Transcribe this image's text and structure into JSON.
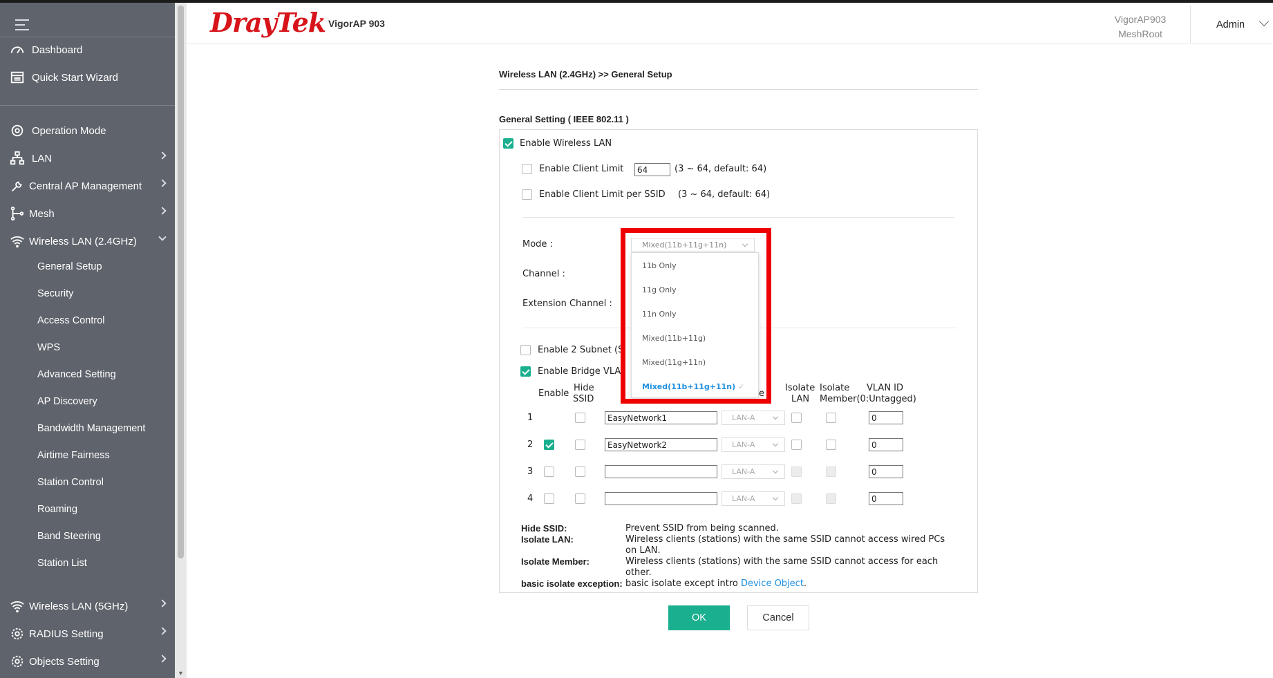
{
  "header": {
    "brand": "DrayTek",
    "model": "VigorAP 903",
    "device_name": "VigorAP903",
    "device_role": "MeshRoot",
    "user": "Admin"
  },
  "sidebar": {
    "items": [
      {
        "label": "Dashboard",
        "icon": "dashboard-icon"
      },
      {
        "label": "Quick Start Wizard",
        "icon": "wizard-icon"
      },
      {
        "label": "Operation Mode",
        "icon": "operation-mode-icon"
      },
      {
        "label": "LAN",
        "icon": "lan-icon"
      },
      {
        "label": "Central AP Management",
        "icon": "wrench-icon"
      },
      {
        "label": "Mesh",
        "icon": "mesh-icon"
      },
      {
        "label": "Wireless LAN (2.4GHz)",
        "icon": "wifi-icon"
      },
      {
        "label": "Wireless LAN (5GHz)",
        "icon": "wifi-icon"
      },
      {
        "label": "RADIUS Setting",
        "icon": "gear-icon"
      },
      {
        "label": "Objects Setting",
        "icon": "gear-icon"
      }
    ],
    "sub_items": [
      "General Setup",
      "Security",
      "Access Control",
      "WPS",
      "Advanced Setting",
      "AP Discovery",
      "Bandwidth Management",
      "Airtime Fairness",
      "Station Control",
      "Roaming",
      "Band Steering",
      "Station List"
    ]
  },
  "main": {
    "breadcrumb": "Wireless LAN (2.4GHz) >> General Setup",
    "section_title": "General Setting ( IEEE 802.11 )",
    "enable_wlan": "Enable Wireless LAN",
    "client_limit_label": "Enable Client Limit",
    "client_limit_value": "64",
    "client_limit_hint": "(3 ~ 64, default: 64)",
    "client_limit_ssid_label": "Enable Client Limit per SSID",
    "client_limit_ssid_hint": "(3 ~ 64, default: 64)",
    "mode_label": "Mode :",
    "channel_label": "Channel :",
    "ext_channel_label": "Extension Channel :",
    "mode_selected": "Mixed(11b+11g+11n)",
    "mode_options": [
      "11b Only",
      "11g Only",
      "11n Only",
      "Mixed(11b+11g)",
      "Mixed(11g+11n)",
      "Mixed(11b+11g+11n)"
    ],
    "subnet_label": "Enable 2 Subnet (Si",
    "bridge_vlan_label": "Enable Bridge VLA",
    "table": {
      "col_enable": "Enable",
      "col_hide_ssid_1": "Hide",
      "col_hide_ssid_2": "SSID",
      "col_partial": "e",
      "col_isolate_lan_1": "Isolate",
      "col_isolate_lan_2": "LAN",
      "col_isolate_member_1": "Isolate",
      "col_isolate_member_2": "Member(0:Untagged)",
      "col_vlan": "VLAN ID",
      "rows": [
        {
          "num": "1",
          "ssid": "EasyNetwork1",
          "lan": "LAN-A",
          "vlan": "0"
        },
        {
          "num": "2",
          "ssid": "EasyNetwork2",
          "lan": "LAN-A",
          "vlan": "0"
        },
        {
          "num": "3",
          "ssid": "",
          "lan": "LAN-A",
          "vlan": "0"
        },
        {
          "num": "4",
          "ssid": "",
          "lan": "LAN-A",
          "vlan": "0"
        }
      ]
    },
    "legend": {
      "hide_ssid_key": "Hide SSID:",
      "hide_ssid_val": "Prevent SSID from being scanned.",
      "isolate_lan_key": "Isolate LAN:",
      "isolate_lan_val": "Wireless clients (stations) with the same SSID cannot access wired PCs on LAN.",
      "isolate_member_key": "Isolate Member:",
      "isolate_member_val": "Wireless clients (stations) with the same SSID cannot access for each other.",
      "exception_key": "basic isolate exception:",
      "exception_val": "basic isolate except intro ",
      "exception_link": "Device Object",
      "exception_end": "."
    },
    "ok_label": "OK",
    "cancel_label": "Cancel"
  },
  "colors": {
    "accent": "#1aaf8e",
    "brand": "#d7141a",
    "sidebar": "#5f636b",
    "highlight": "#ee0000",
    "link": "#1e8fe0"
  }
}
